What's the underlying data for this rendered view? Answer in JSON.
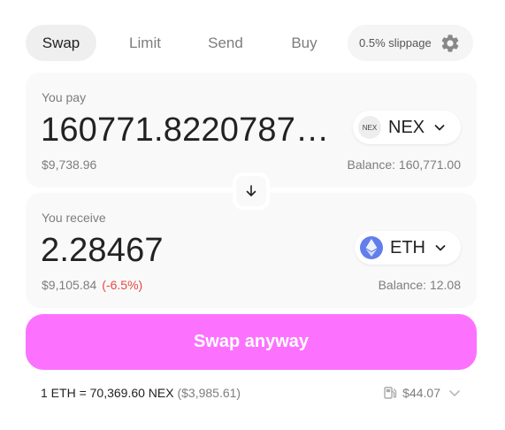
{
  "tabs": [
    {
      "label": "Swap"
    },
    {
      "label": "Limit"
    },
    {
      "label": "Send"
    },
    {
      "label": "Buy"
    }
  ],
  "slippage": {
    "label": "0.5% slippage"
  },
  "pay": {
    "label": "You pay",
    "amount": "160771.82207871…",
    "usd": "$9,738.96",
    "balance": "Balance: 160,771.00",
    "token": {
      "symbol": "NEX",
      "logo_text": "NEX"
    }
  },
  "receive": {
    "label": "You receive",
    "amount": "2.28467",
    "usd": "$9,105.84",
    "price_impact": "(-6.5%)",
    "balance": "Balance: 12.08",
    "token": {
      "symbol": "ETH"
    }
  },
  "swap_button": {
    "label": "Swap anyway"
  },
  "footer": {
    "rate": "1 ETH = 70,369.60 NEX",
    "rate_usd": "($3,985.61)",
    "gas": "$44.07"
  },
  "colors": {
    "accent": "#fc72ff",
    "negative": "#e8473f",
    "eth": "#627eea",
    "panel": "#f9f9f9"
  },
  "icons": [
    "gear-icon",
    "chevron-down-icon",
    "arrow-down-icon",
    "eth-logo-icon",
    "gas-pump-icon"
  ]
}
